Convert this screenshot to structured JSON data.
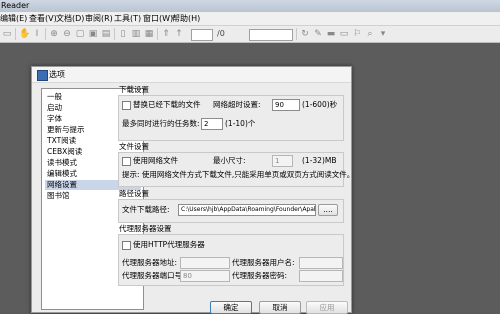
{
  "app": {
    "title": "Reader"
  },
  "menu": [
    {
      "label": "编辑(E)"
    },
    {
      "label": "查看(V)"
    },
    {
      "label": "文档(D)"
    },
    {
      "label": "审阅(R)"
    },
    {
      "label": "工具(T)"
    },
    {
      "label": "窗口(W)"
    },
    {
      "label": "帮助(H)"
    }
  ],
  "toolbar": {
    "page_separator": "/0"
  },
  "dialog": {
    "title": "选项",
    "nav_items": [
      "一般",
      "启动",
      "字体",
      "更新与提示",
      "TXT阅读",
      "CEBX阅读",
      "读书模式",
      "编辑模式",
      "网络设置",
      "图书馆"
    ],
    "selected_index": 8,
    "download": {
      "group_title": "下载设置",
      "no_cache_label": "替换已经下载的文件",
      "timeout_label": "网络超时设置:",
      "timeout_value": "90",
      "timeout_range": "(1-600)秒",
      "max_tasks_label": "最多同时进行的任务数:",
      "max_tasks_value": "2",
      "max_tasks_range": "(1-10)个"
    },
    "file": {
      "group_title": "文件设置",
      "use_net_label": "使用网络文件",
      "min_size_label": "最小尺寸:",
      "min_size_value": "1",
      "min_size_range": "(1-32)MB",
      "hint": "提示: 使用网络文件方式下载文件,只能采用单页或双页方式阅读文件。"
    },
    "path": {
      "group_title": "路径设置",
      "download_path_label": "文件下载路径:",
      "download_path_value": "C:\\Users\\hjb\\AppData\\Roaming\\Founder\\Apabi Rea",
      "browse_label": "...."
    },
    "proxy": {
      "group_title": "代理服务器设置",
      "use_proxy_label": "使用HTTP代理服务器",
      "address_label": "代理服务器地址:",
      "user_label": "代理服务器用户名:",
      "port_label": "代理服务器端口号:",
      "port_value": "80",
      "password_label": "代理服务器密码:"
    },
    "buttons": {
      "ok": "确定",
      "cancel": "取消",
      "apply": "应用"
    }
  }
}
